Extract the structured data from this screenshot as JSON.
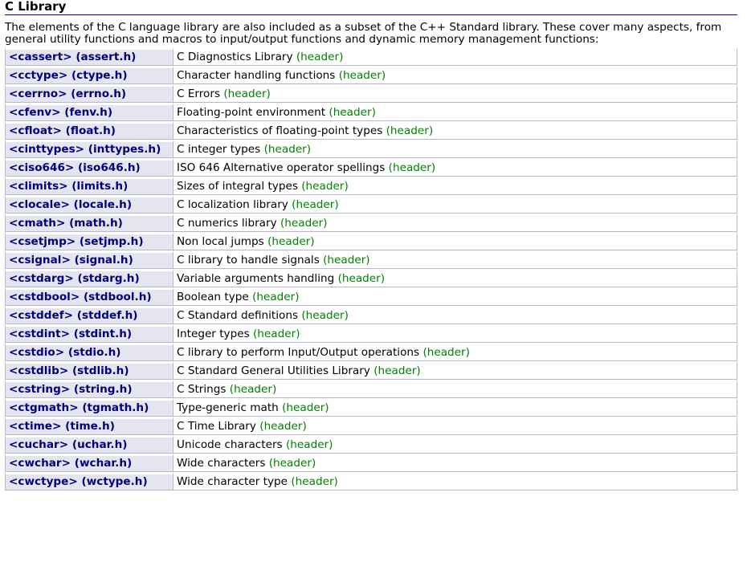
{
  "section": {
    "title": "C Library",
    "intro": "The elements of the C language library are also included as a subset of the C++ Standard library. These cover many aspects, from general utility functions and macros to input/output functions and dynamic memory management functions:"
  },
  "colors": {
    "link": "#00007f",
    "kind": "#008000",
    "header_cell_bg": "#e5e5ef",
    "border": "#b8b8cc"
  },
  "rows": [
    {
      "header": "<cassert> (assert.h)",
      "description": "C Diagnostics Library",
      "kind": "(header)"
    },
    {
      "header": "<cctype> (ctype.h)",
      "description": "Character handling functions",
      "kind": "(header)"
    },
    {
      "header": "<cerrno> (errno.h)",
      "description": "C Errors",
      "kind": "(header)"
    },
    {
      "header": "<cfenv> (fenv.h)",
      "description": "Floating-point environment",
      "kind": "(header)"
    },
    {
      "header": "<cfloat> (float.h)",
      "description": "Characteristics of floating-point types",
      "kind": "(header)"
    },
    {
      "header": "<cinttypes> (inttypes.h)",
      "description": "C integer types",
      "kind": "(header)"
    },
    {
      "header": "<ciso646> (iso646.h)",
      "description": "ISO 646 Alternative operator spellings",
      "kind": "(header)"
    },
    {
      "header": "<climits> (limits.h)",
      "description": "Sizes of integral types",
      "kind": "(header)"
    },
    {
      "header": "<clocale> (locale.h)",
      "description": "C localization library",
      "kind": "(header)"
    },
    {
      "header": "<cmath> (math.h)",
      "description": "C numerics library",
      "kind": "(header)"
    },
    {
      "header": "<csetjmp> (setjmp.h)",
      "description": "Non local jumps",
      "kind": "(header)"
    },
    {
      "header": "<csignal> (signal.h)",
      "description": "C library to handle signals",
      "kind": "(header)"
    },
    {
      "header": "<cstdarg> (stdarg.h)",
      "description": "Variable arguments handling",
      "kind": "(header)"
    },
    {
      "header": "<cstdbool> (stdbool.h)",
      "description": "Boolean type",
      "kind": "(header)"
    },
    {
      "header": "<cstddef> (stddef.h)",
      "description": "C Standard definitions",
      "kind": "(header)"
    },
    {
      "header": "<cstdint> (stdint.h)",
      "description": "Integer types",
      "kind": "(header)"
    },
    {
      "header": "<cstdio> (stdio.h)",
      "description": "C library to perform Input/Output operations",
      "kind": "(header)"
    },
    {
      "header": "<cstdlib> (stdlib.h)",
      "description": "C Standard General Utilities Library",
      "kind": "(header)"
    },
    {
      "header": "<cstring> (string.h)",
      "description": "C Strings",
      "kind": "(header)"
    },
    {
      "header": "<ctgmath> (tgmath.h)",
      "description": "Type-generic math",
      "kind": "(header)"
    },
    {
      "header": "<ctime> (time.h)",
      "description": "C Time Library",
      "kind": "(header)"
    },
    {
      "header": "<cuchar> (uchar.h)",
      "description": "Unicode characters",
      "kind": "(header)"
    },
    {
      "header": "<cwchar> (wchar.h)",
      "description": "Wide characters",
      "kind": "(header)"
    },
    {
      "header": "<cwctype> (wctype.h)",
      "description": "Wide character type",
      "kind": "(header)"
    }
  ]
}
